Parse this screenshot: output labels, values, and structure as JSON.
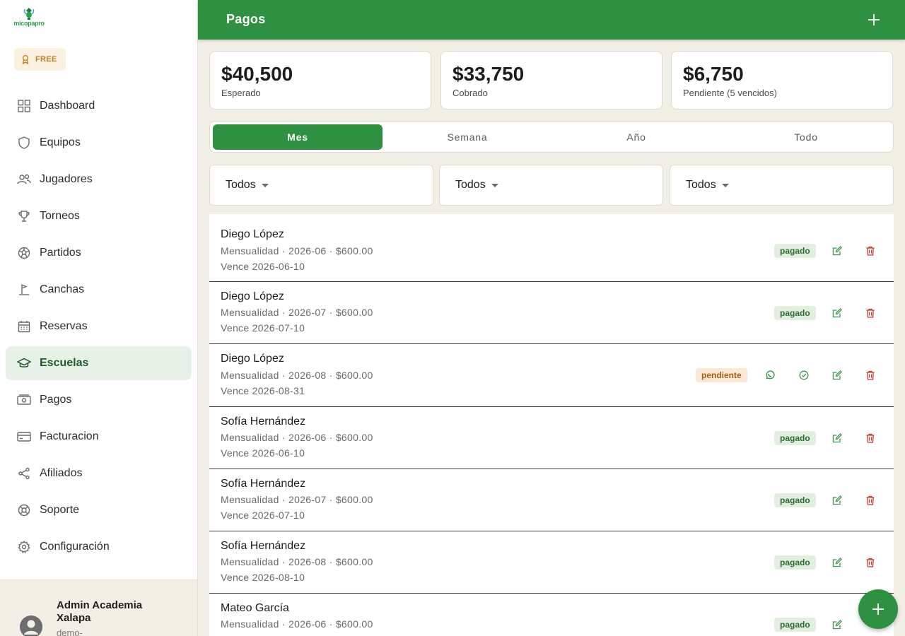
{
  "brand": {
    "logo_text": "micopapro",
    "plan": "FREE"
  },
  "nav": [
    {
      "label": "Dashboard",
      "icon": "grid-icon"
    },
    {
      "label": "Equipos",
      "icon": "shield-icon"
    },
    {
      "label": "Jugadores",
      "icon": "users-icon"
    },
    {
      "label": "Torneos",
      "icon": "trophy-icon"
    },
    {
      "label": "Partidos",
      "icon": "soccer-ball-icon"
    },
    {
      "label": "Canchas",
      "icon": "field-flag-icon"
    },
    {
      "label": "Reservas",
      "icon": "calendar-icon"
    },
    {
      "label": "Escuelas",
      "icon": "graduation-cap-icon",
      "active": true
    },
    {
      "label": "Pagos",
      "icon": "cash-icon"
    },
    {
      "label": "Facturacion",
      "icon": "credit-card-icon"
    },
    {
      "label": "Afiliados",
      "icon": "share-icon"
    },
    {
      "label": "Soporte",
      "icon": "lifebuoy-icon"
    },
    {
      "label": "Configuración",
      "icon": "gear-icon"
    }
  ],
  "user": {
    "name": "Admin Academia Xalapa",
    "sub": "demo-"
  },
  "header": {
    "title": "Pagos"
  },
  "summary": [
    {
      "amount": "$40,500",
      "caption": "Esperado"
    },
    {
      "amount": "$33,750",
      "caption": "Cobrado"
    },
    {
      "amount": "$6,750",
      "caption": "Pendiente (5 vencidos)"
    }
  ],
  "tabs": [
    {
      "label": "Mes",
      "active": true
    },
    {
      "label": "Semana"
    },
    {
      "label": "Año"
    },
    {
      "label": "Todo"
    }
  ],
  "filters": [
    {
      "value": "Todos"
    },
    {
      "value": "Todos"
    },
    {
      "value": "Todos"
    }
  ],
  "payments": [
    {
      "name": "Diego López",
      "detail": "Mensualidad · 2026-06 · $600.00",
      "due": "Vence 2026-06-10",
      "status": "pagado"
    },
    {
      "name": "Diego López",
      "detail": "Mensualidad · 2026-07 · $600.00",
      "due": "Vence 2026-07-10",
      "status": "pagado"
    },
    {
      "name": "Diego López",
      "detail": "Mensualidad · 2026-08 · $600.00",
      "due": "Vence 2026-08-31",
      "status": "pendiente"
    },
    {
      "name": "Sofía Hernández",
      "detail": "Mensualidad · 2026-06 · $600.00",
      "due": "Vence 2026-06-10",
      "status": "pagado"
    },
    {
      "name": "Sofía Hernández",
      "detail": "Mensualidad · 2026-07 · $600.00",
      "due": "Vence 2026-07-10",
      "status": "pagado"
    },
    {
      "name": "Sofía Hernández",
      "detail": "Mensualidad · 2026-08 · $600.00",
      "due": "Vence 2026-08-10",
      "status": "pagado"
    },
    {
      "name": "Mateo García",
      "detail": "Mensualidad · 2026-06 · $600.00",
      "due": "",
      "status": "pagado"
    }
  ],
  "colors": {
    "brand_green": "#2e9142",
    "active_nav_bg": "#e8f1e7",
    "delete_red": "#c0392b",
    "pending_orange": "#a35d1b"
  }
}
